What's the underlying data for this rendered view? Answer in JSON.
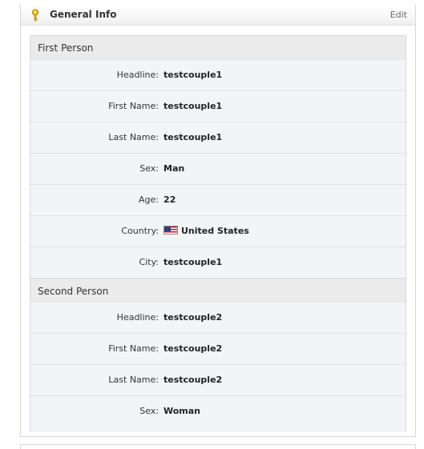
{
  "panel": {
    "title": "General Info",
    "edit_label": "Edit",
    "icon": "key-icon",
    "accent_color": "#e8b400"
  },
  "first_person": {
    "heading": "First Person",
    "rows": [
      {
        "label": "Headline:",
        "value": "testcouple1"
      },
      {
        "label": "First Name:",
        "value": "testcouple1"
      },
      {
        "label": "Last Name:",
        "value": "testcouple1"
      },
      {
        "label": "Sex:",
        "value": "Man"
      },
      {
        "label": "Age:",
        "value": "22"
      },
      {
        "label": "Country:",
        "value": "United States",
        "icon": "us-flag-icon"
      },
      {
        "label": "City:",
        "value": "testcouple1"
      }
    ]
  },
  "second_person": {
    "heading": "Second Person",
    "rows": [
      {
        "label": "Headline:",
        "value": "testcouple2"
      },
      {
        "label": "First Name:",
        "value": "testcouple2"
      },
      {
        "label": "Last Name:",
        "value": "testcouple2"
      },
      {
        "label": "Sex:",
        "value": "Woman"
      }
    ]
  }
}
